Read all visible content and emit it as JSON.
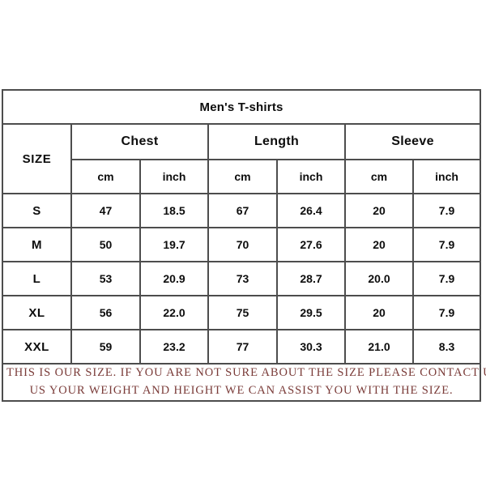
{
  "table": {
    "title": "Men's T-shirts",
    "size_header": "SIZE",
    "groups": [
      {
        "label": "Chest",
        "units": [
          "cm",
          "inch"
        ]
      },
      {
        "label": "Length",
        "units": [
          "cm",
          "inch"
        ]
      },
      {
        "label": "Sleeve",
        "units": [
          "cm",
          "inch"
        ]
      }
    ],
    "rows": [
      {
        "size": "S",
        "chest_cm": "47",
        "chest_inch": "18.5",
        "length_cm": "67",
        "length_inch": "26.4",
        "sleeve_cm": "20",
        "sleeve_inch": "7.9"
      },
      {
        "size": "M",
        "chest_cm": "50",
        "chest_inch": "19.7",
        "length_cm": "70",
        "length_inch": "27.6",
        "sleeve_cm": "20",
        "sleeve_inch": "7.9"
      },
      {
        "size": "L",
        "chest_cm": "53",
        "chest_inch": "20.9",
        "length_cm": "73",
        "length_inch": "28.7",
        "sleeve_cm": "20.0",
        "sleeve_inch": "7.9"
      },
      {
        "size": "XL",
        "chest_cm": "56",
        "chest_inch": "22.0",
        "length_cm": "75",
        "length_inch": "29.5",
        "sleeve_cm": "20",
        "sleeve_inch": "7.9"
      },
      {
        "size": "XXL",
        "chest_cm": "59",
        "chest_inch": "23.2",
        "length_cm": "77",
        "length_inch": "30.3",
        "sleeve_cm": "21.0",
        "sleeve_inch": "8.3"
      }
    ],
    "note": {
      "line1": "THIS IS OUR SIZE. IF YOU ARE NOT SURE ABOUT THE SIZE  PLEASE CONTACT US AND TELL",
      "line2": "US YOUR WEIGHT AND HEIGHT WE CAN ASSIST YOU WITH THE SIZE."
    },
    "colors": {
      "title_bar": "#c6c6c6",
      "border": "#4d4d4d",
      "note_text": "#7a3b38",
      "cell_background": "#ffffff"
    }
  }
}
